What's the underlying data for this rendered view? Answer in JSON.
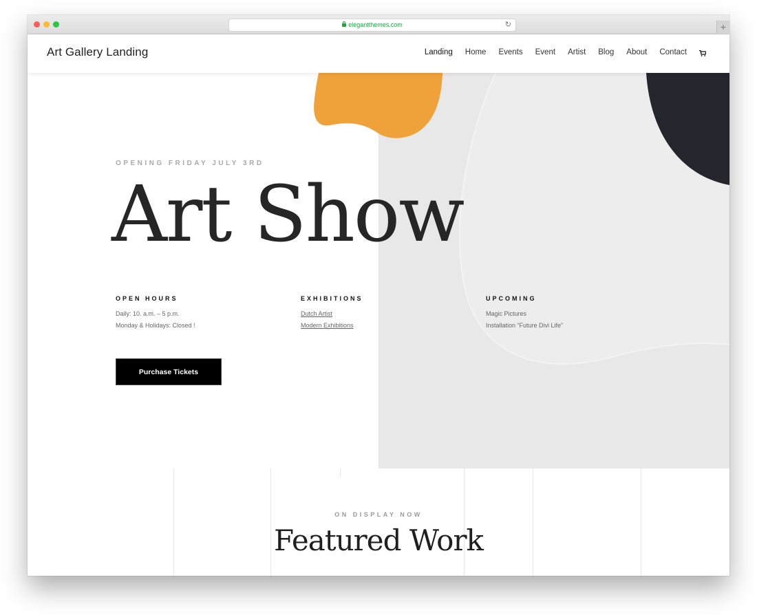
{
  "browser": {
    "url": "elegantthemes.com",
    "new_tab_label": "+"
  },
  "header": {
    "site_title": "Art Gallery Landing",
    "nav": [
      "Landing",
      "Home",
      "Events",
      "Event",
      "Artist",
      "Blog",
      "About",
      "Contact"
    ],
    "cart_icon": "cart-icon"
  },
  "hero": {
    "eyebrow": "OPENING FRIDAY JULY 3RD",
    "title": "Art Show",
    "open_hours": {
      "heading": "OPEN HOURS",
      "lines": [
        "Daily: 10. a.m. – 5 p.m.",
        "Monday & Holidays: Closed !"
      ]
    },
    "exhibitions": {
      "heading": "EXHIBITIONS",
      "links": [
        "Dutch Artist",
        "Modern Exhibitions"
      ]
    },
    "upcoming": {
      "heading": "UPCOMING",
      "lines": [
        "Magic Pictures",
        "Installation “Future Divi Life”"
      ]
    },
    "button": "Purchase Tickets"
  },
  "featured": {
    "eyebrow": "ON DISPLAY NOW",
    "title": "Featured Work"
  },
  "colors": {
    "accent_orange": "#f0a23a",
    "dark_navy": "#25252d",
    "panel_gray": "#e9e8e9"
  }
}
